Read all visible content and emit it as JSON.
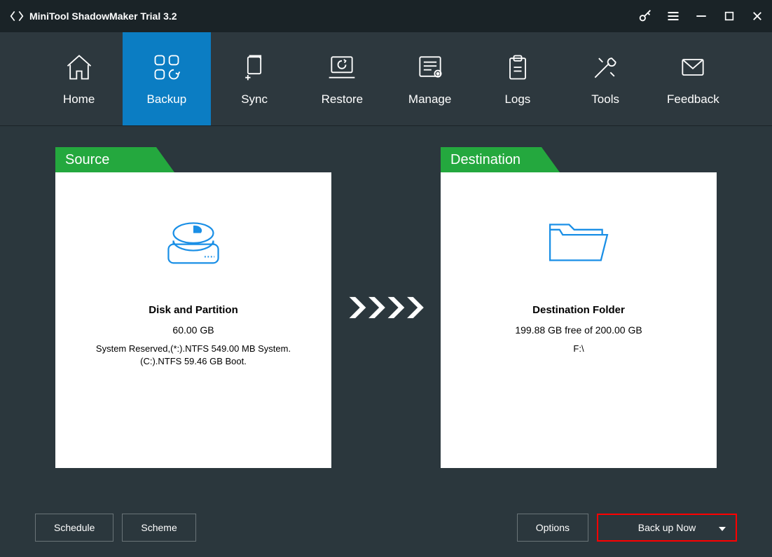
{
  "title": "MiniTool ShadowMaker Trial 3.2",
  "nav": [
    {
      "label": "Home"
    },
    {
      "label": "Backup"
    },
    {
      "label": "Sync"
    },
    {
      "label": "Restore"
    },
    {
      "label": "Manage"
    },
    {
      "label": "Logs"
    },
    {
      "label": "Tools"
    },
    {
      "label": "Feedback"
    }
  ],
  "source": {
    "tab": "Source",
    "title": "Disk and Partition",
    "size": "60.00 GB",
    "line1": "System Reserved,(*:).NTFS 549.00 MB System.",
    "line2": "(C:).NTFS 59.46 GB Boot."
  },
  "destination": {
    "tab": "Destination",
    "title": "Destination Folder",
    "free": "199.88 GB free of 200.00 GB",
    "path": "F:\\"
  },
  "buttons": {
    "schedule": "Schedule",
    "scheme": "Scheme",
    "options": "Options",
    "backup_now": "Back up Now"
  }
}
